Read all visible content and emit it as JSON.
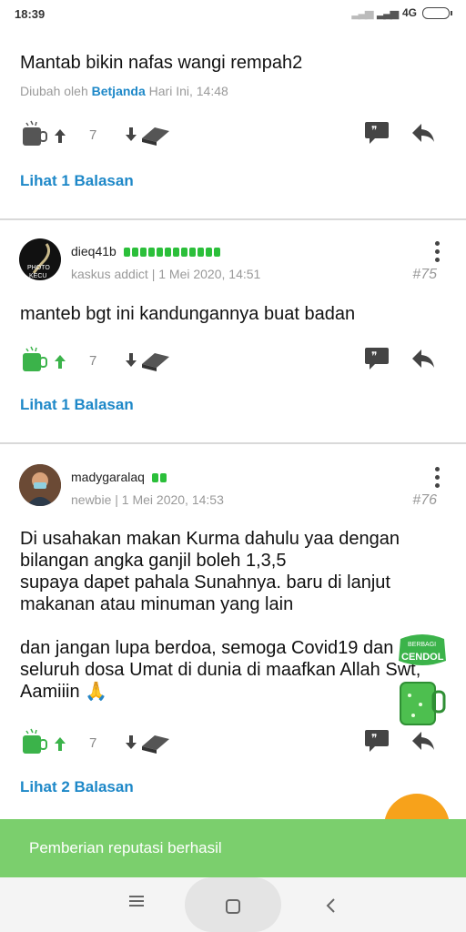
{
  "status": {
    "time": "18:39",
    "network": "4G"
  },
  "posts": [
    {
      "text": "Mantab bikin nafas wangi rempah2",
      "edited_prefix": "Diubah oleh",
      "edited_by": "Betjanda",
      "edited_time": "Hari Ini, 14:48",
      "vote_count": "7",
      "reply_link": "Lihat 1 Balasan"
    },
    {
      "username": "dieq41b",
      "rank": "kaskus addict | 1 Mei 2020, 14:51",
      "number": "#75",
      "avatar_text": "PHOTO KECU",
      "text": "manteb bgt ini kandungannya buat badan",
      "vote_count": "7",
      "reply_link": "Lihat 1 Balasan"
    },
    {
      "username": "madygaralaq",
      "rank": "newbie | 1 Mei 2020, 14:53",
      "number": "#76",
      "text_lines": [
        "Di usahakan makan Kurma dahulu yaa dengan",
        "bilangan angka ganjil boleh 1,3,5",
        "supaya dapet pahala Sunahnya. baru di lanjut",
        "makanan atau minuman yang lain",
        "",
        "dan jangan lupa berdoa, semoga Covid19 dan",
        "seluruh dosa Umat di dunia di maafkan Allah Swt,",
        "Aamiiin 🙏"
      ],
      "vote_count": "7",
      "reply_link": "Lihat 2 Balasan"
    }
  ],
  "cendol_badge": {
    "line1": "BERBAGI",
    "line2": "CENDOL"
  },
  "toast": "Pemberian reputasi berhasil",
  "colors": {
    "link": "#1e88c8",
    "rank_bar": "#2bbf3a",
    "toast": "#7bcf6d",
    "fab": "#f7a21b"
  }
}
